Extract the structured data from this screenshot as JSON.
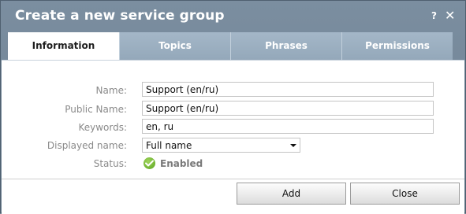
{
  "dialog": {
    "title": "Create a new service group",
    "help_label": "?",
    "close_label": "✕"
  },
  "tabs": [
    {
      "label": "Information",
      "active": true
    },
    {
      "label": "Topics",
      "active": false
    },
    {
      "label": "Phrases",
      "active": false
    },
    {
      "label": "Permissions",
      "active": false
    }
  ],
  "form": {
    "name": {
      "label": "Name:",
      "value": "Support (en/ru)"
    },
    "public_name": {
      "label": "Public Name:",
      "value": "Support (en/ru)"
    },
    "keywords": {
      "label": "Keywords:",
      "value": "en, ru"
    },
    "displayed_name": {
      "label": "Displayed name:",
      "value": "Full name"
    },
    "status": {
      "label": "Status:",
      "value": "Enabled",
      "icon": "check-circle-icon"
    }
  },
  "footer": {
    "add_label": "Add",
    "close_label": "Close"
  },
  "colors": {
    "titlebar": "#7b8ea0",
    "tab_inactive": "#9cb0c2",
    "status_green": "#5aa51f"
  }
}
